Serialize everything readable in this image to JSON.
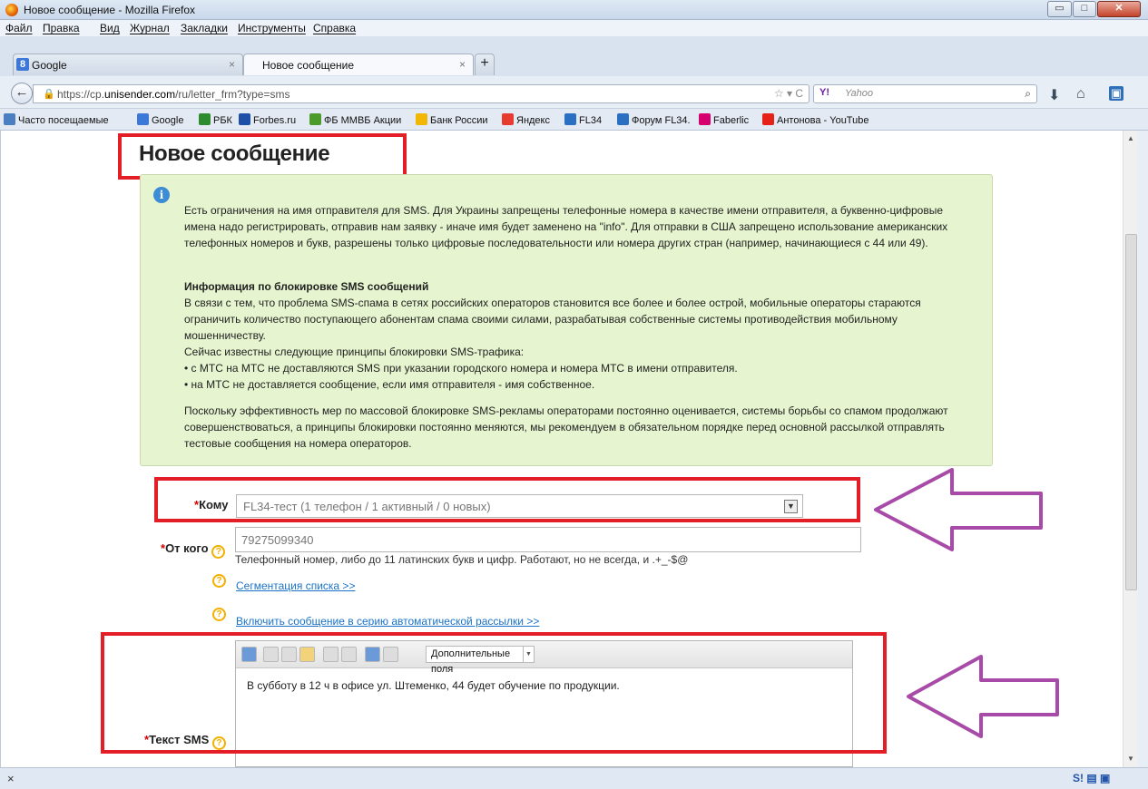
{
  "window": {
    "title": "Новое сообщение - Mozilla Firefox",
    "min_glyph": "▭",
    "max_glyph": "□",
    "close_glyph": "✕"
  },
  "menu": [
    "Файл",
    "Правка",
    "Вид",
    "Журнал",
    "Закладки",
    "Инструменты",
    "Справка"
  ],
  "tabs": [
    {
      "label": "Google",
      "close": "×"
    },
    {
      "label": "Новое сообщение",
      "close": "×"
    }
  ],
  "new_tab_glyph": "+",
  "navbar": {
    "url_prefix": "https://cp.",
    "url_domain": "unisender.com",
    "url_rest": "/ru/letter_frm?type=sms",
    "search_placeholder": "Yahoo",
    "yahoo_logo": "Y!",
    "url_tools": "☆ ▾ C"
  },
  "bookmarks": [
    {
      "label": "Часто посещаемые",
      "color": "#4a7fc1"
    },
    {
      "label": "Google",
      "color": "#3c78d8"
    },
    {
      "label": "РБК",
      "color": "#2e8b2e"
    },
    {
      "label": "Forbes.ru",
      "color": "#1d4fa8"
    },
    {
      "label": "ФБ ММВБ Акции",
      "color": "#4c9a2a"
    },
    {
      "label": "Банк России",
      "color": "#f2b705"
    },
    {
      "label": "Яндекс",
      "color": "#e63b2e"
    },
    {
      "label": "FL34",
      "color": "#2b6fc2"
    },
    {
      "label": "Форум FL34.",
      "color": "#2b6fc2"
    },
    {
      "label": "Faberlic",
      "color": "#d6006f"
    },
    {
      "label": "Антонова - YouTube",
      "color": "#e62117"
    }
  ],
  "page": {
    "title": "Новое сообщение",
    "info_icon": "i",
    "info_para1": "Есть ограничения на имя отправителя для SMS. Для Украины запрещены телефонные номера в качестве имени отправителя, а буквенно-цифровые имена надо регистрировать, отправив нам заявку - иначе имя будет заменено на \"info\". Для отправки в США запрещено использование американских телефонных номеров и букв, разрешены только цифровые последовательности или номера других стран (например, начинающиеся с 44 или 49).",
    "info_heading": "Информация по блокировке SMS сообщений",
    "info_para2": "В связи с тем, что проблема SMS-спама в сетях российских операторов становится все более и более острой, мобильные операторы стараются ограничить количество поступающего абонентам спама своими силами, разрабатывая собственные системы противодействия мобильному мошенничеству.",
    "info_para2b": "Сейчас известны следующие принципы блокировки SMS-трафика:",
    "info_bullet1": "• с МТС на МТС не доставляются SMS при указании городского номера и номера МТС в имени отправителя.",
    "info_bullet2": "• на МТС не доставляется сообщение, если имя отправителя - имя собственное.",
    "info_para3": "Поскольку эффективность мер по массовой блокировке SMS-рекламы операторами постоянно оценивается, системы борьбы со спамом продолжают совершенствоваться, а принципы блокировки постоянно меняются, мы рекомендуем в обязательном порядке перед основной рассылкой отправлять тестовые сообщения на номера операторов."
  },
  "form": {
    "required_mark": "*",
    "to_label": "Кому",
    "to_value": "FL34-тест   (1 телефон / 1 активный / 0 новых)",
    "from_label": "От кого",
    "from_value": "79275099340",
    "from_hint": "Телефонный номер, либо до 11 латинских букв и цифр. Работают, но не всегда, и .+_-$@",
    "segment_link": "Сегментация списка >>",
    "auto_link": "Включить сообщение в серию автоматической рассылки >>",
    "help_glyph": "?",
    "text_label": "Текст SMS",
    "extra_fields": "Дополнительные поля",
    "sms_text": "В субботу в 12 ч в офисе ул. Штеменко, 44 будет обучение по продукции."
  },
  "status": {
    "close_glyph": "×",
    "icons": "S! ▤ ▣"
  },
  "colors": {
    "annotation_red": "#e41e26",
    "annotation_purple": "#a84ba8",
    "info_bg": "#e6f5cf",
    "link": "#1a73c9"
  }
}
